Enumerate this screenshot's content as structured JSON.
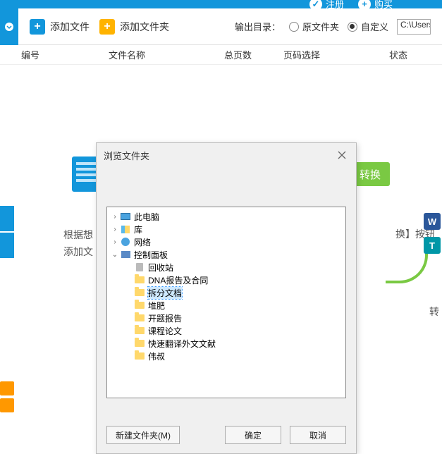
{
  "topbar": {
    "register": "注册",
    "buy": "购买"
  },
  "toolbar": {
    "add_file": "添加文件",
    "add_folder": "添加文件夹",
    "output_label": "输出目录：",
    "radio_original": "原文件夹",
    "radio_custom": "自定义",
    "path_value": "C:\\Users\\"
  },
  "columns": {
    "c1": "编号",
    "c2": "文件名称",
    "c3": "总页数",
    "c4": "页码选择",
    "c5": "状态"
  },
  "hints": {
    "left_line1": "根据想",
    "left_line2": "添加文",
    "right_btn": "转换",
    "right_text": "换】按钮",
    "right_label": "转"
  },
  "dialog": {
    "title": "浏览文件夹",
    "new_folder": "新建文件夹(M)",
    "ok": "确定",
    "cancel": "取消",
    "tree": [
      {
        "indent": 0,
        "arrow": "›",
        "icon": "pc",
        "label": "此电脑"
      },
      {
        "indent": 0,
        "arrow": "›",
        "icon": "lib",
        "label": "库"
      },
      {
        "indent": 0,
        "arrow": "›",
        "icon": "net",
        "label": "网络"
      },
      {
        "indent": 0,
        "arrow": "v",
        "icon": "panel",
        "label": "控制面板"
      },
      {
        "indent": 1,
        "arrow": "",
        "icon": "recycle",
        "label": "回收站"
      },
      {
        "indent": 1,
        "arrow": "",
        "icon": "folder",
        "label": "DNA报告及合同"
      },
      {
        "indent": 1,
        "arrow": "",
        "icon": "folder",
        "label": "拆分文档",
        "selected": true
      },
      {
        "indent": 1,
        "arrow": "",
        "icon": "folder",
        "label": "堆肥"
      },
      {
        "indent": 1,
        "arrow": "",
        "icon": "folder",
        "label": "开题报告"
      },
      {
        "indent": 1,
        "arrow": "",
        "icon": "folder",
        "label": "课程论文"
      },
      {
        "indent": 1,
        "arrow": "",
        "icon": "folder",
        "label": "快速翻译外文文献"
      },
      {
        "indent": 1,
        "arrow": "",
        "icon": "folder",
        "label": "伟叔"
      }
    ]
  },
  "mini_right": {
    "w": "W",
    "t": "T"
  }
}
